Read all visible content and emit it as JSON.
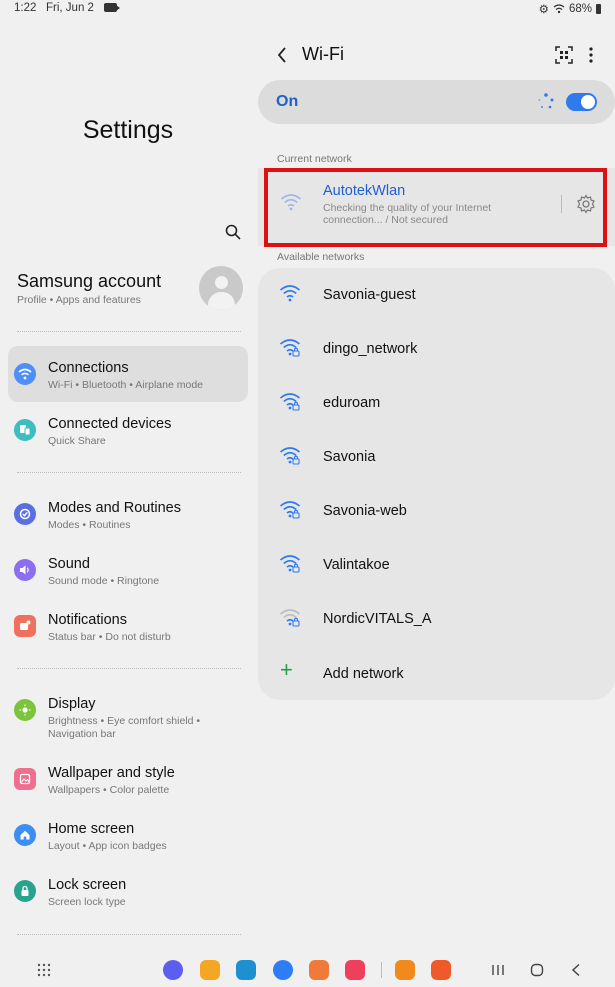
{
  "status_bar": {
    "time": "1:22",
    "date": "Fri, Jun 2",
    "battery": "68%"
  },
  "left": {
    "title": "Settings",
    "account": {
      "name": "Samsung account",
      "sub": "Profile  •  Apps and features"
    },
    "items": [
      {
        "title": "Connections",
        "sub": "Wi-Fi  •  Bluetooth  •  Airplane mode",
        "icon": "wifi-icon",
        "color": "#4f8ef7"
      },
      {
        "title": "Connected devices",
        "sub": "Quick Share",
        "icon": "devices-icon",
        "color": "#3dbcc1"
      },
      {
        "title": "Modes and Routines",
        "sub": "Modes  •  Routines",
        "icon": "routines-icon",
        "color": "#5a6fe0"
      },
      {
        "title": "Sound",
        "sub": "Sound mode  •  Ringtone",
        "icon": "sound-icon",
        "color": "#8b6ff0"
      },
      {
        "title": "Notifications",
        "sub": "Status bar  •  Do not disturb",
        "icon": "notifications-icon",
        "color": "#f07060"
      },
      {
        "title": "Display",
        "sub": "Brightness  •  Eye comfort shield  •  Navigation bar",
        "icon": "display-icon",
        "color": "#7cc43a"
      },
      {
        "title": "Wallpaper and style",
        "sub": "Wallpapers  •  Color palette",
        "icon": "wallpaper-icon",
        "color": "#ee6f8e"
      },
      {
        "title": "Home screen",
        "sub": "Layout  •  App icon badges",
        "icon": "home-icon",
        "color": "#3d8ef0"
      },
      {
        "title": "Lock screen",
        "sub": "Screen lock type",
        "icon": "lock-icon",
        "color": "#2aa38e"
      }
    ]
  },
  "wifi": {
    "title": "Wi-Fi",
    "toggle_label": "On",
    "toggle_on": true,
    "current_label": "Current network",
    "current": {
      "name": "AutotekWlan",
      "status_line1": "Checking the quality of your Internet",
      "status_line2": "connection... / Not secured"
    },
    "available_label": "Available networks",
    "networks": [
      {
        "name": "Savonia-guest",
        "secured": false
      },
      {
        "name": "dingo_network",
        "secured": true
      },
      {
        "name": "eduroam",
        "secured": true
      },
      {
        "name": "Savonia",
        "secured": true
      },
      {
        "name": "Savonia-web",
        "secured": true
      },
      {
        "name": "Valintakoe",
        "secured": true
      },
      {
        "name": "NordicVITALS_A",
        "secured": true
      }
    ],
    "add_network": "Add network"
  },
  "navbar": {
    "apps": [
      {
        "name": "internet-app-icon",
        "color": "#5c5ef0"
      },
      {
        "name": "files-app-icon",
        "color": "#f5a623"
      },
      {
        "name": "calendar-app-icon",
        "color": "#1e8fcf"
      },
      {
        "name": "messages-app-icon",
        "color": "#2e7cf6"
      },
      {
        "name": "contacts-app-icon",
        "color": "#f07a3a"
      },
      {
        "name": "screen-recorder-app-icon",
        "color": "#ee3f5c"
      },
      {
        "name": "notes-app-icon",
        "color": "#f08a1c"
      },
      {
        "name": "camera-app-icon",
        "color": "#f05a2a"
      }
    ]
  }
}
